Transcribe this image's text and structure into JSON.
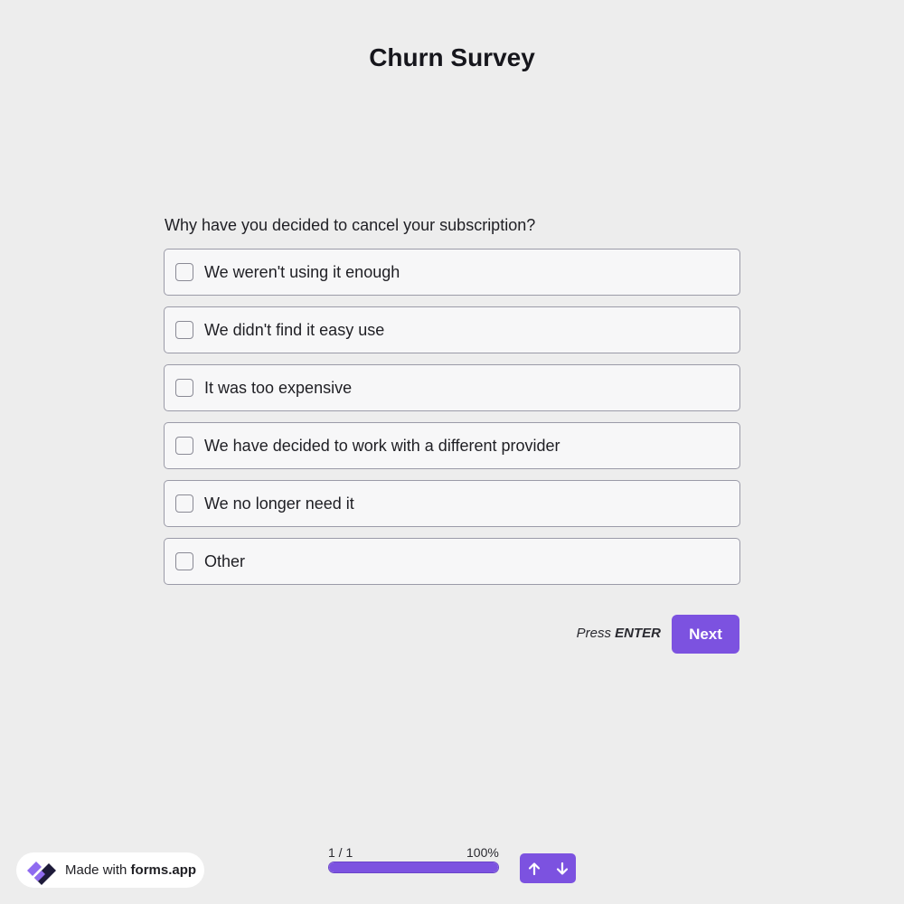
{
  "survey": {
    "title": "Churn Survey"
  },
  "question": {
    "text": "Why have you decided to cancel your subscription?",
    "options": [
      {
        "label": "We weren't using it enough",
        "checked": false
      },
      {
        "label": "We didn't find it easy use",
        "checked": false
      },
      {
        "label": "It was too expensive",
        "checked": false
      },
      {
        "label": "We have decided to work with a different provider",
        "checked": false
      },
      {
        "label": "We no longer need it",
        "checked": false
      },
      {
        "label": "Other",
        "checked": false
      }
    ]
  },
  "actions": {
    "press_label": "Press",
    "enter_key": "ENTER",
    "next_label": "Next"
  },
  "footer": {
    "badge_prefix": "Made with",
    "badge_brand": "forms.app",
    "progress_counter": "1 / 1",
    "progress_percent_text": "100%",
    "progress_fraction": 1.0,
    "nav_up_icon": "arrow-up-icon",
    "nav_down_icon": "arrow-down-icon"
  },
  "colors": {
    "accent": "#7c52e0",
    "background": "#ededed",
    "option_background": "#f7f7f8",
    "option_border": "#9b9ba8"
  }
}
